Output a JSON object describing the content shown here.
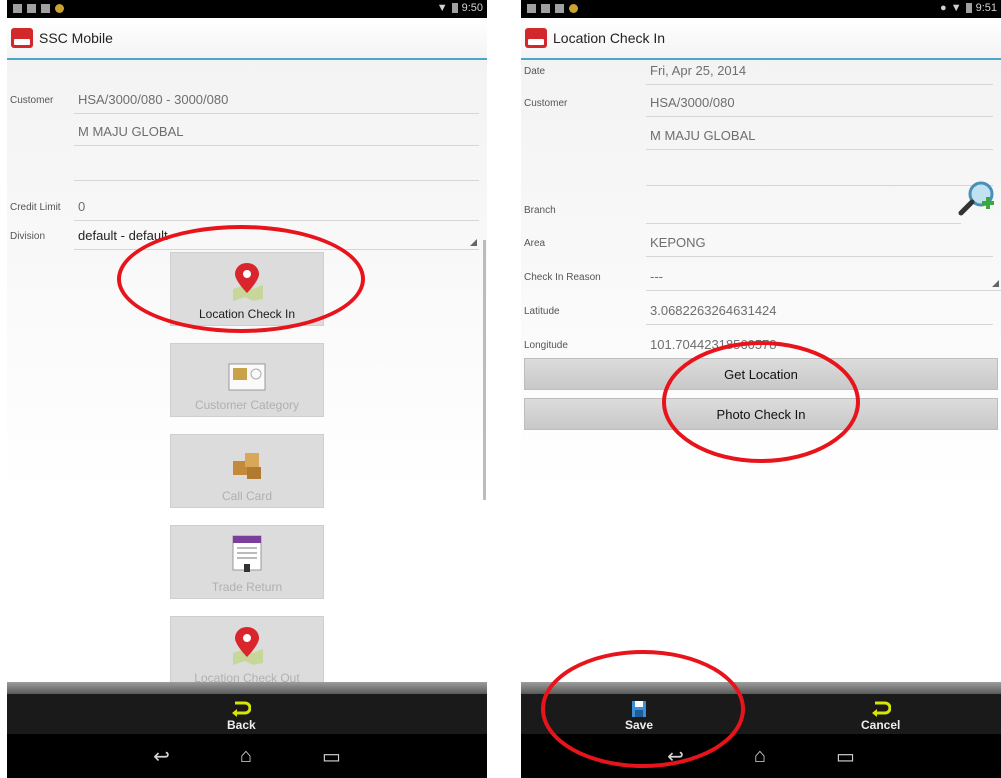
{
  "left": {
    "status_time": "9:50",
    "title": "SSC Mobile",
    "fields": [
      {
        "label": "Customer",
        "value": "HSA/3000/080 - 3000/080"
      },
      {
        "label": "",
        "value": "M MAJU GLOBAL"
      },
      {
        "label": "",
        "value": ""
      },
      {
        "label": "Credit Limit",
        "value": "0"
      },
      {
        "label": "Division",
        "value": "default - default"
      }
    ],
    "tiles": [
      {
        "label": "Location Check In",
        "icon": "map-pin-icon"
      },
      {
        "label": "Customer Category",
        "icon": "contact-card-icon"
      },
      {
        "label": "Call Card",
        "icon": "boxes-icon"
      },
      {
        "label": "Trade Return",
        "icon": "return-form-icon"
      },
      {
        "label": "Location Check Out",
        "icon": "map-pin-icon"
      }
    ],
    "back_label": "Back"
  },
  "right": {
    "status_time": "9:51",
    "title": "Location Check In",
    "date_label": "Date",
    "date_value": "Fri, Apr 25, 2014",
    "customer_label": "Customer",
    "customer_value": "HSA/3000/080",
    "customer_name": "M MAJU GLOBAL",
    "branch_label": "Branch",
    "branch_value": "",
    "area_label": "Area",
    "area_value": "KEPONG",
    "reason_label": "Check In Reason",
    "reason_value": "---",
    "lat_label": "Latitude",
    "lat_value": "3.0682263264631424",
    "lng_label": "Longitude",
    "lng_value": "101.70442318560578",
    "get_location": "Get Location",
    "photo_check_in": "Photo Check In",
    "save_label": "Save",
    "cancel_label": "Cancel"
  },
  "colors": {
    "accent": "#4ba6c9",
    "annotation": "#e8141b",
    "pin": "#d9262c"
  }
}
